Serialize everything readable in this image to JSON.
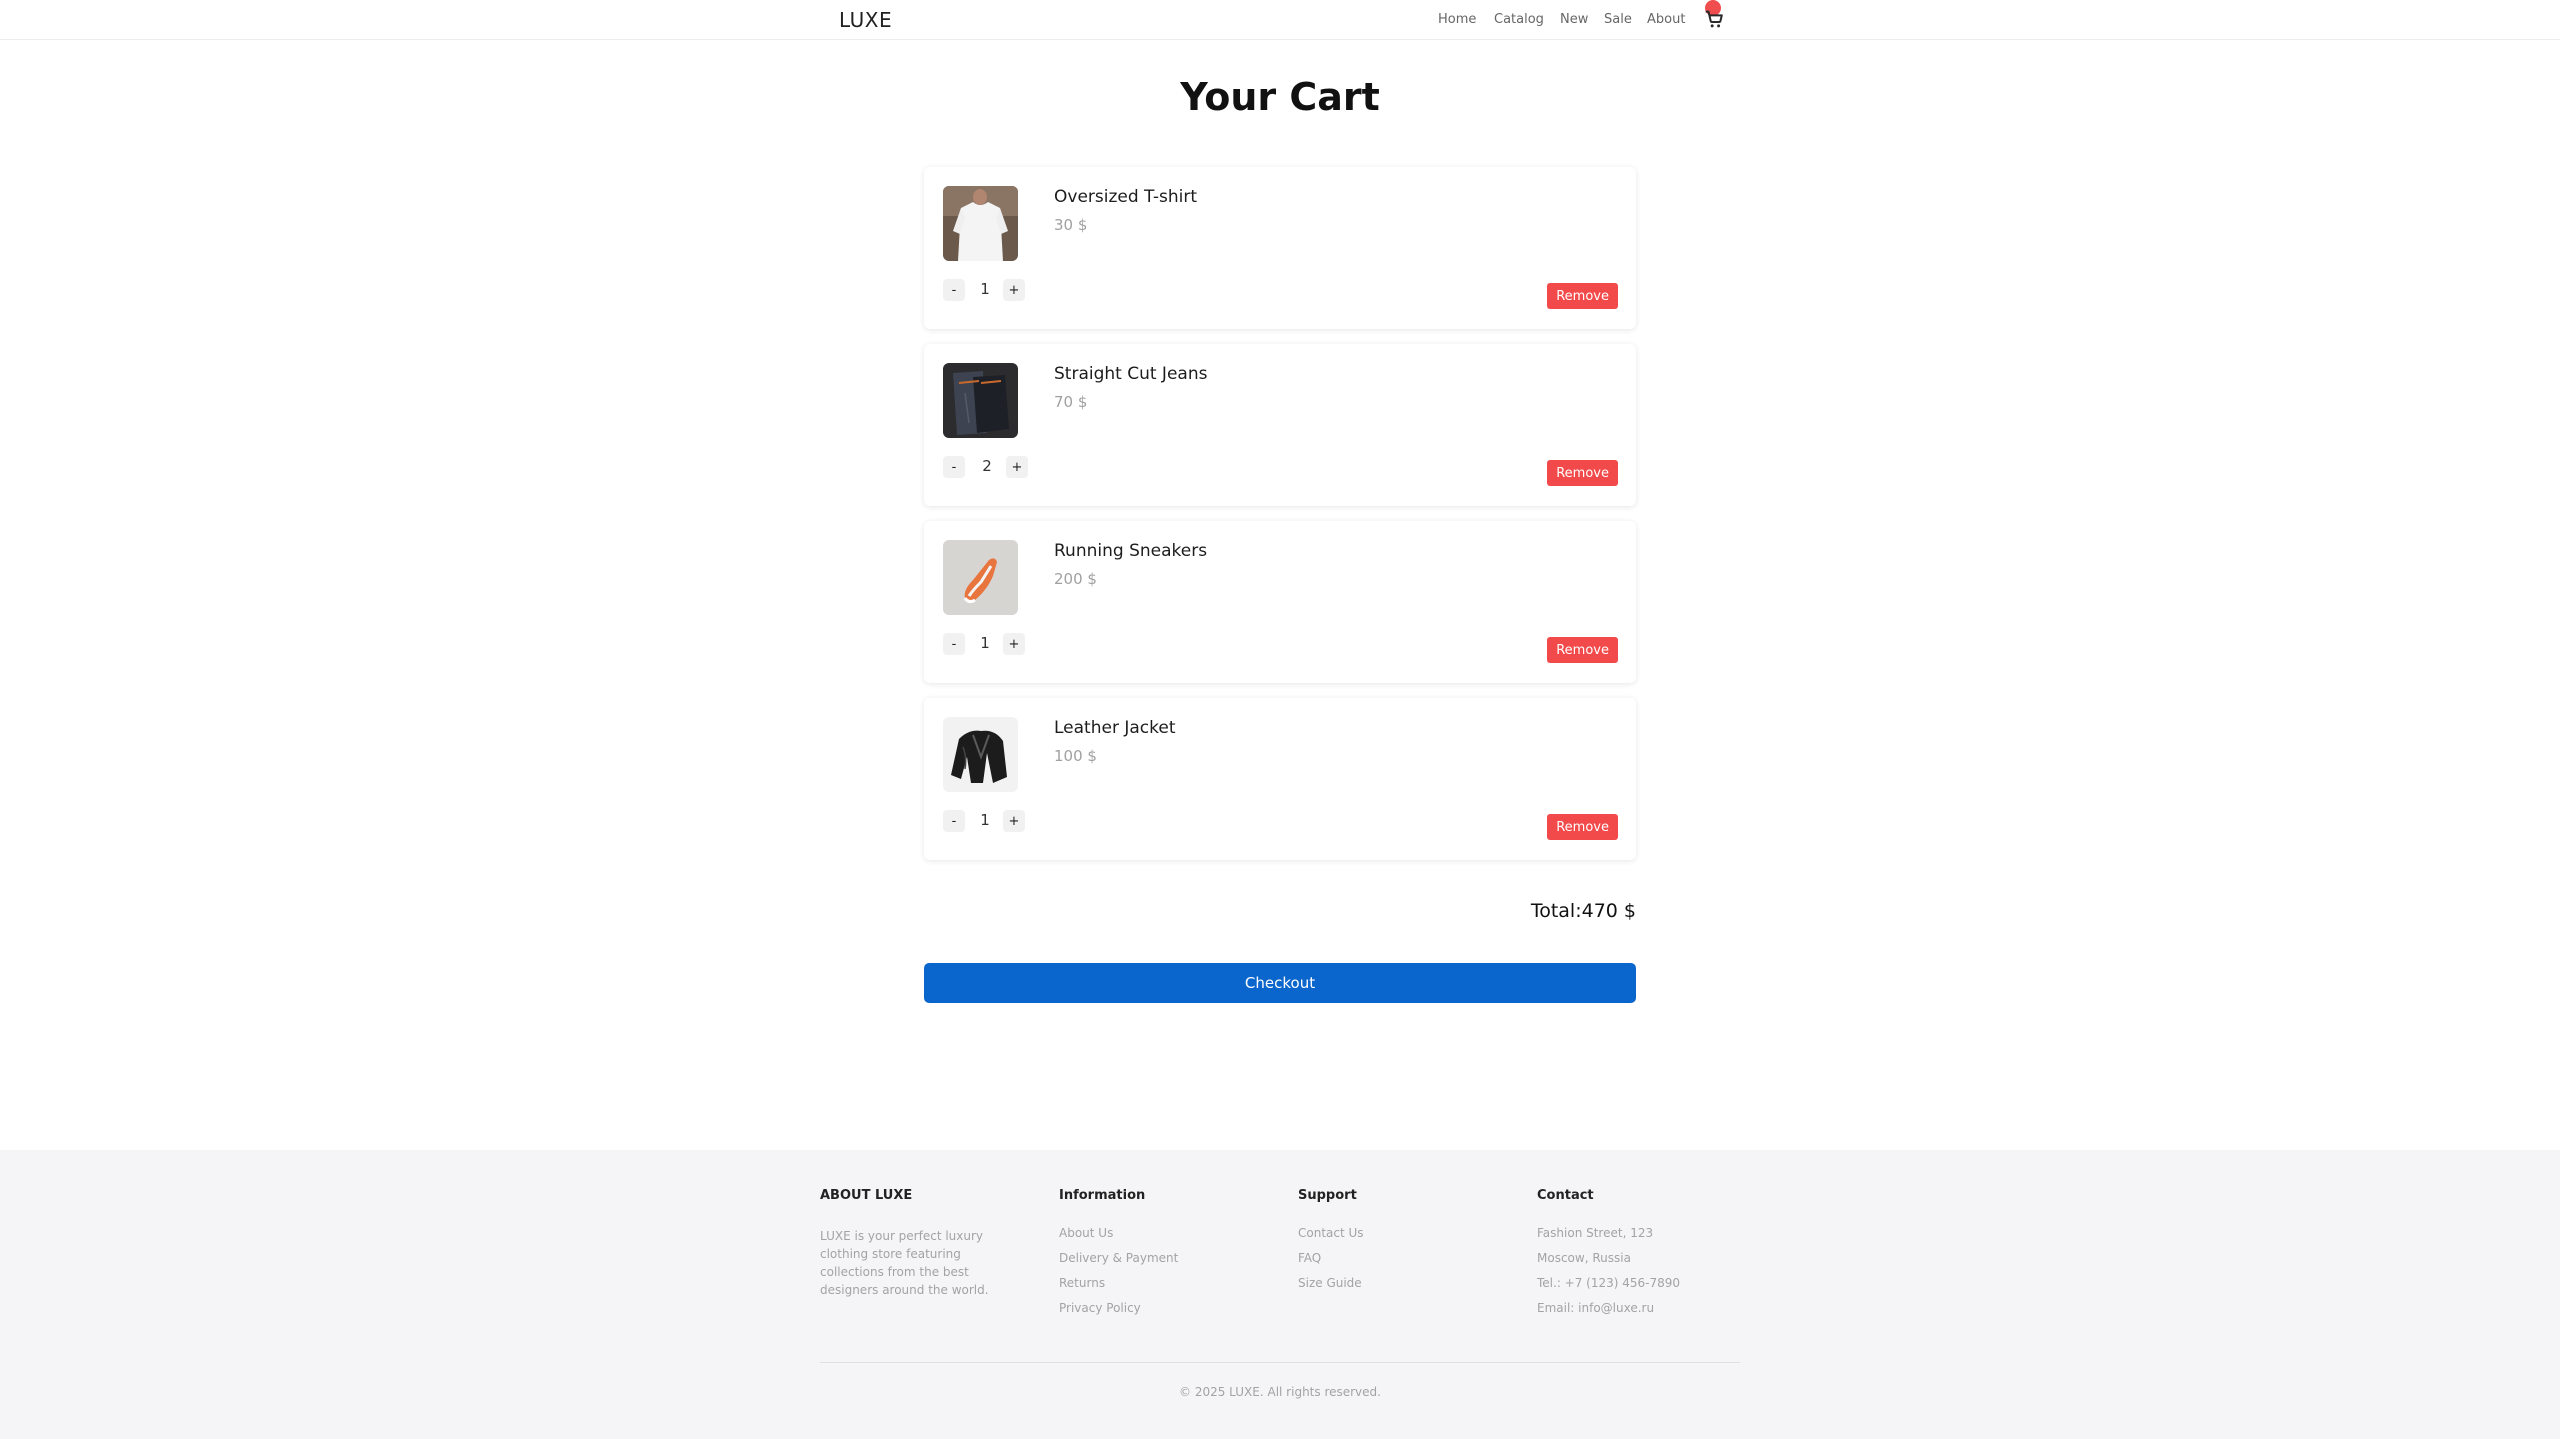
{
  "header": {
    "logo": "LUXE",
    "nav": [
      "Home",
      "Catalog",
      "New",
      "Sale",
      "About"
    ]
  },
  "cart": {
    "title": "Your Cart",
    "items": [
      {
        "name": "Oversized T-shirt",
        "price": "30 $",
        "qty": "1",
        "remove": "Remove",
        "minus": "-",
        "plus": "+"
      },
      {
        "name": "Straight Cut Jeans",
        "price": "70 $",
        "qty": "2",
        "remove": "Remove",
        "minus": "-",
        "plus": "+"
      },
      {
        "name": "Running Sneakers",
        "price": "200 $",
        "qty": "1",
        "remove": "Remove",
        "minus": "-",
        "plus": "+"
      },
      {
        "name": "Leather Jacket",
        "price": "100 $",
        "qty": "1",
        "remove": "Remove",
        "minus": "-",
        "plus": "+"
      }
    ],
    "total": "Total:470 $",
    "checkout": "Checkout"
  },
  "footer": {
    "about_head": "ABOUT LUXE",
    "about_text": "LUXE is your perfect luxury clothing store featuring collections from the best designers around the world.",
    "info_head": "Information",
    "info_links": [
      "About Us",
      "Delivery & Payment",
      "Returns",
      "Privacy Policy"
    ],
    "support_head": "Support",
    "support_links": [
      "Contact Us",
      "FAQ",
      "Size Guide"
    ],
    "contact_head": "Contact",
    "contact_lines": [
      "Fashion Street, 123",
      "Moscow, Russia",
      "Tel.: +7 (123) 456-7890",
      "Email: info@luxe.ru"
    ],
    "copyright": "© 2025 LUXE. All rights reserved."
  },
  "colors": {
    "accent": "#0a66cc",
    "danger": "#f24a4a",
    "muted": "#a3a3a3"
  }
}
